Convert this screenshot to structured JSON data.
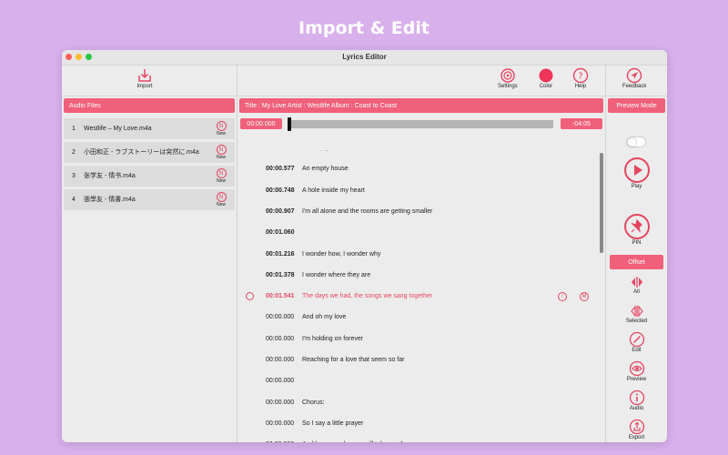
{
  "headline": "Import & Edit",
  "window": {
    "title": "Lyrics Editor"
  },
  "left": {
    "import_label": "Import",
    "section_label": "Audio Files",
    "files": [
      {
        "index": "1",
        "name": "Westlife – My Love.m4a",
        "badge": "New"
      },
      {
        "index": "2",
        "name": "小田和正 - ラブストーリーは突然に.m4a",
        "badge": "New"
      },
      {
        "index": "3",
        "name": "张学友 - 情书.m4a",
        "badge": "New"
      },
      {
        "index": "4",
        "name": "張學友 - 情書.m4a",
        "badge": "New"
      }
    ]
  },
  "middle": {
    "settings_label": "Settings",
    "color_label": "Color",
    "help_label": "Help",
    "track_info": "Title : My Love   Artist : Westlife   Album : Coast to Coast",
    "elapsed": "00:00.000",
    "remaining": "-04:05",
    "lyrics": [
      {
        "time": "00:00.411",
        "text": "An empty street",
        "bold": true
      },
      {
        "time": "00:00.577",
        "text": "An empty house",
        "bold": true
      },
      {
        "time": "00:00.748",
        "text": "A hole inside my heart",
        "bold": true
      },
      {
        "time": "00:00.907",
        "text": "I'm all alone and the rooms are getting smaller",
        "bold": true
      },
      {
        "time": "00:01.060",
        "text": "",
        "bold": true
      },
      {
        "time": "00:01.216",
        "text": "I wonder how, I wonder why",
        "bold": true
      },
      {
        "time": "00:01.378",
        "text": "I wonder where they are",
        "bold": true
      },
      {
        "time": "00:01.541",
        "text": "The days we had, the songs we sang together",
        "bold": true,
        "active": true
      },
      {
        "time": "00:00.000",
        "text": "And oh my love",
        "bold": false
      },
      {
        "time": "00:00.000",
        "text": "I'm holding on forever",
        "bold": false
      },
      {
        "time": "00:00.000",
        "text": "Reaching for a love that seem so far",
        "bold": false
      },
      {
        "time": "00:00.000",
        "text": "",
        "bold": false
      },
      {
        "time": "00:00.000",
        "text": "Chorus:",
        "bold": false
      },
      {
        "time": "00:00.000",
        "text": "So I say a little prayer",
        "bold": false
      },
      {
        "time": "00:00.000",
        "text": "And hope my dreams will take me there",
        "bold": false
      }
    ]
  },
  "right": {
    "feedback_label": "Feedback",
    "preview_mode_label": "Preview Mode",
    "preview_mode_on": false,
    "play_label": "Play",
    "pin_label": "PIN",
    "offset_label": "Offset",
    "all_label": "All",
    "selected_label": "Selected",
    "edit_label": "Edit",
    "preview_label": "Preview",
    "audio_label": "Audio",
    "export_label": "Export"
  },
  "colors": {
    "accent": "#f0607a",
    "accent_dark": "#e64560",
    "background": "#d8b0ec"
  }
}
